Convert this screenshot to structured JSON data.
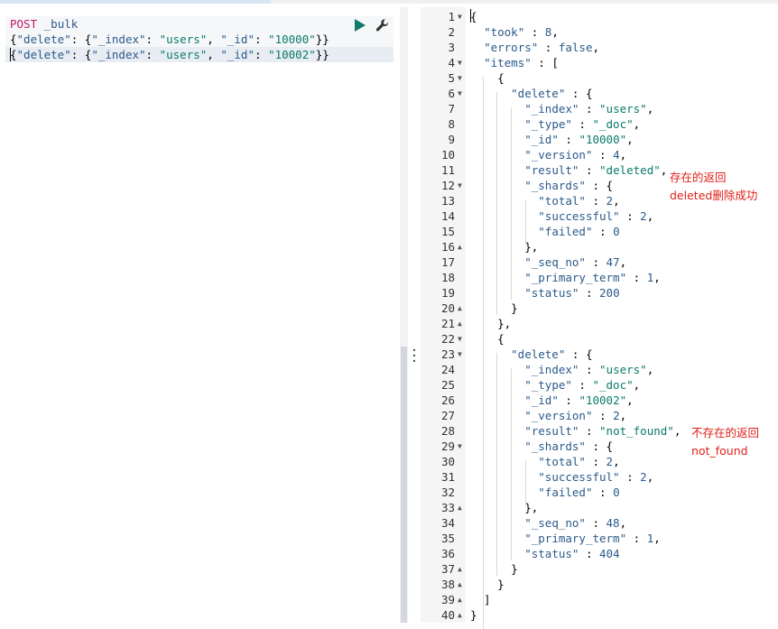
{
  "request": {
    "method": "POST",
    "endpoint": "_bulk",
    "lines": [
      "{\"delete\": {\"_index\": \"users\", \"_id\": \"10000\"}}",
      "{\"delete\": {\"_index\": \"users\", \"_id\": \"10002\"}}"
    ]
  },
  "toolbar": {
    "run_icon": "play-icon",
    "settings_icon": "wrench-icon"
  },
  "response": {
    "line_numbers": [
      "1",
      "2",
      "3",
      "4",
      "5",
      "6",
      "7",
      "8",
      "9",
      "10",
      "11",
      "12",
      "13",
      "14",
      "15",
      "16",
      "17",
      "18",
      "19",
      "20",
      "21",
      "22",
      "23",
      "24",
      "25",
      "26",
      "27",
      "28",
      "29",
      "30",
      "31",
      "32",
      "33",
      "34",
      "35",
      "36",
      "37",
      "38",
      "39",
      "40"
    ],
    "code_lines": [
      "{",
      "  \"took\" : 8,",
      "  \"errors\" : false,",
      "  \"items\" : [",
      "    {",
      "      \"delete\" : {",
      "        \"_index\" : \"users\",",
      "        \"_type\" : \"_doc\",",
      "        \"_id\" : \"10000\",",
      "        \"_version\" : 4,",
      "        \"result\" : \"deleted\",",
      "        \"_shards\" : {",
      "          \"total\" : 2,",
      "          \"successful\" : 2,",
      "          \"failed\" : 0",
      "        },",
      "        \"_seq_no\" : 47,",
      "        \"_primary_term\" : 1,",
      "        \"status\" : 200",
      "      }",
      "    },",
      "    {",
      "      \"delete\" : {",
      "        \"_index\" : \"users\",",
      "        \"_type\" : \"_doc\",",
      "        \"_id\" : \"10002\",",
      "        \"_version\" : 2,",
      "        \"result\" : \"not_found\",",
      "        \"_shards\" : {",
      "          \"total\" : 2,",
      "          \"successful\" : 2,",
      "          \"failed\" : 0",
      "        },",
      "        \"_seq_no\" : 48,",
      "        \"_primary_term\" : 1,",
      "        \"status\" : 404",
      "      }",
      "    }",
      "  ]",
      "}"
    ]
  },
  "annotations": {
    "deleted_note_line1": "存在的返回",
    "deleted_note_line2": "deleted删除成功",
    "not_found_note_line1": "不存在的返回",
    "not_found_note_line2": "not_found"
  },
  "colors": {
    "annotation": "#e0201a",
    "run_button": "#0f7c6b",
    "method": "#c01868"
  }
}
